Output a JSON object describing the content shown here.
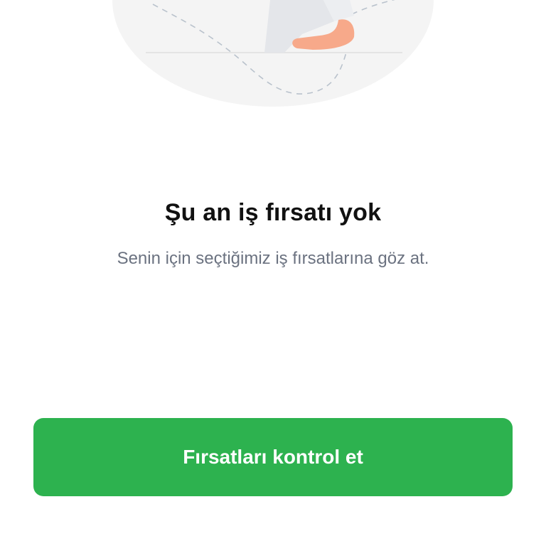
{
  "empty_state": {
    "title": "Şu an iş fırsatı yok",
    "subtitle": "Senin için seçtiğimiz iş fırsatlarına göz at.",
    "illustration_icon": "person-at-desk-illustration"
  },
  "cta": {
    "label": "Fırsatları kontrol et",
    "color": "#2db24f"
  }
}
